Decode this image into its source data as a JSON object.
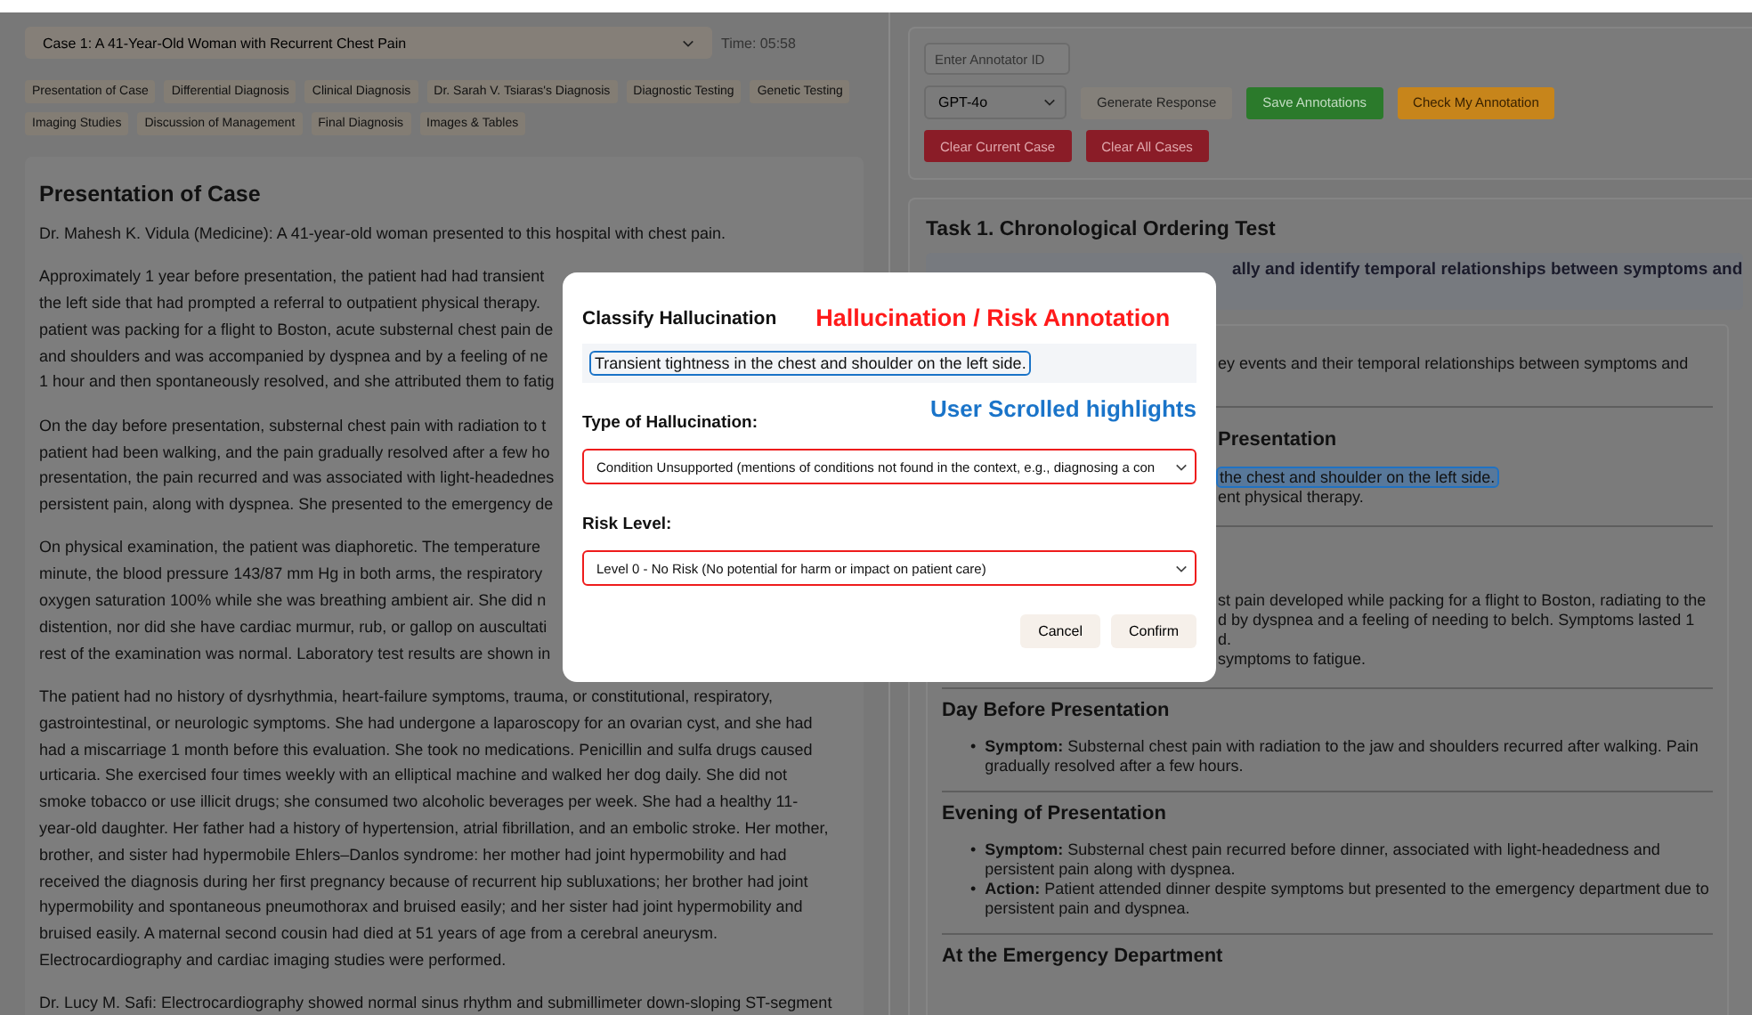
{
  "case_selector": {
    "value": "Case 1: A 41-Year-Old Woman with Recurrent Chest Pain",
    "timer": "Time: 05:58"
  },
  "section_tabs": [
    {
      "label": "Presentation of Case"
    },
    {
      "label": "Differential Diagnosis"
    },
    {
      "label": "Clinical Diagnosis"
    },
    {
      "label": "Dr. Sarah V. Tsiaras's Diagnosis"
    },
    {
      "label": "Diagnostic Testing"
    },
    {
      "label": "Genetic Testing"
    },
    {
      "label": "Imaging Studies"
    },
    {
      "label": "Discussion of Management"
    },
    {
      "label": "Final Diagnosis"
    },
    {
      "label": "Images & Tables"
    }
  ],
  "case_text": {
    "heading": "Presentation of Case",
    "paragraphs": [
      [
        "Dr. Mahesh K. Vidula (Medicine): A 41-year-old woman presented to this hospital with chest pain."
      ],
      [
        "Approximately 1 year before presentation, the patient had had transient",
        "the left side that had prompted a referral to outpatient physical therapy.",
        "patient was packing for a flight to Boston, acute substernal chest pain de",
        "and shoulders and was accompanied by dyspnea and by a feeling of ne",
        "1 hour and then spontaneously resolved, and she attributed them to fatig"
      ],
      [
        "On the day before presentation, substernal chest pain with radiation to t",
        "patient had been walking, and the pain gradually resolved after a few ho",
        "presentation, the pain recurred and was associated with light-headednes",
        "persistent pain, along with dyspnea. She presented to the emergency de"
      ],
      [
        "On physical examination, the patient was diaphoretic. The temperature",
        "minute, the blood pressure 143/87 mm Hg in both arms, the respiratory",
        "oxygen saturation 100% while she was breathing ambient air. She did n",
        "distention, nor did she have cardiac murmur, rub, or gallop on auscultati",
        "rest of the examination was normal. Laboratory test results are shown in"
      ],
      [
        "The patient had no history of dysrhythmia, heart-failure symptoms, trauma, or constitutional, respiratory,",
        "gastrointestinal, or neurologic symptoms. She had undergone a laparoscopy for an ovarian cyst, and she had",
        "had a miscarriage 1 month before this evaluation. She took no medications. Penicillin and sulfa drugs caused",
        "urticaria. She exercised four times weekly with an elliptical machine and walked her dog daily. She did not",
        "smoke tobacco or use illicit drugs; she consumed two alcoholic beverages per week. She had a healthy 11-",
        "year-old daughter. Her father had a history of hypertension, atrial fibrillation, and an embolic stroke. Her mother,",
        "brother, and sister had hypermobile Ehlers–Danlos syndrome: her mother had joint hypermobility and had",
        "received the diagnosis during her first pregnancy because of recurrent hip subluxations; her brother had joint",
        "hypermobility and spontaneous pneumothorax and bruised easily; and her sister had joint hypermobility and",
        "bruised easily. A maternal second cousin had died at 51 years of age from a cerebral aneurysm.",
        "Electrocardiography and cardiac imaging studies were performed."
      ],
      [
        "Dr. Lucy M. Safi: Electrocardiography showed normal sinus rhythm and submillimeter down-sloping ST-segment"
      ]
    ]
  },
  "annotator_panel": {
    "annotator_id": {
      "placeholder": "Enter Annotator ID"
    },
    "model_select": {
      "value": "GPT-4o"
    },
    "buttons": [
      {
        "label": "Generate Response",
        "kind": "neutral"
      },
      {
        "label": "Save Annotations",
        "kind": "save"
      },
      {
        "label": "Check My Annotation",
        "kind": "check"
      },
      {
        "label": "Clear Current Case",
        "kind": "danger"
      },
      {
        "label": "Clear All Cases",
        "kind": "danger"
      }
    ]
  },
  "task": {
    "title": "Task 1. Chronological Ordering Test",
    "question": "ally and identify temporal relationships between symptoms and",
    "behind_dialog": [
      [
        {
          "kind": "text",
          "text": "ey events and their temporal relationships between symptoms and",
          "highlighted": false
        }
      ],
      [
        {
          "kind": "heading",
          "text": "Presentation"
        },
        {
          "kind": "text",
          "text": "the chest and shoulder on the left side.",
          "highlighted": true
        },
        {
          "kind": "text",
          "text": "ent physical therapy.",
          "highlighted": false
        }
      ],
      [
        {
          "kind": "text",
          "text": "st pain developed while packing for a flight to Boston, radiating to the",
          "highlighted": false
        },
        {
          "kind": "text",
          "text": "d by dyspnea and a feeling of needing to belch. Symptoms lasted 1",
          "highlighted": false
        },
        {
          "kind": "text",
          "text": "d.",
          "highlighted": false
        },
        {
          "kind": "text",
          "text": "symptoms to fatigue.",
          "highlighted": false
        }
      ]
    ],
    "sections": [
      {
        "heading": "Day Before Presentation",
        "bullets": [
          {
            "marker": "•",
            "label": "Symptom:",
            "text": "Substernal chest pain with radiation to the jaw and shoulders recurred after walking. Pain gradually resolved after a few hours."
          }
        ]
      },
      {
        "heading": "Evening of Presentation",
        "bullets": [
          {
            "marker": "•",
            "label": "Symptom:",
            "text": "Substernal chest pain recurred before dinner, associated with light-headedness and persistent pain along with dyspnea."
          },
          {
            "marker": "•",
            "label": "Action:",
            "text": "Patient attended dinner despite symptoms but presented to the emergency department due to persistent pain and dyspnea."
          }
        ]
      },
      {
        "heading": "At the Emergency Department"
      }
    ]
  },
  "dialog": {
    "title": "Classify Hallucination",
    "annotations": [
      {
        "text": "Hallucination / Risk Annotation",
        "color": "#ff1a1a"
      },
      {
        "text": "User Scrolled highlights",
        "color": "#1a74c9"
      }
    ],
    "quote": "Transient tightness in the chest and shoulder on the left side.",
    "fields": [
      {
        "label": "Type of Hallucination:",
        "value": "Condition Unsupported (mentions of conditions not found in the context, e.g., diagnosing a con"
      },
      {
        "label": "Risk Level:",
        "value": "Level 0 - No Risk (No potential for harm or impact on patient care)"
      }
    ],
    "buttons": [
      {
        "label": "Cancel"
      },
      {
        "label": "Confirm"
      }
    ]
  }
}
